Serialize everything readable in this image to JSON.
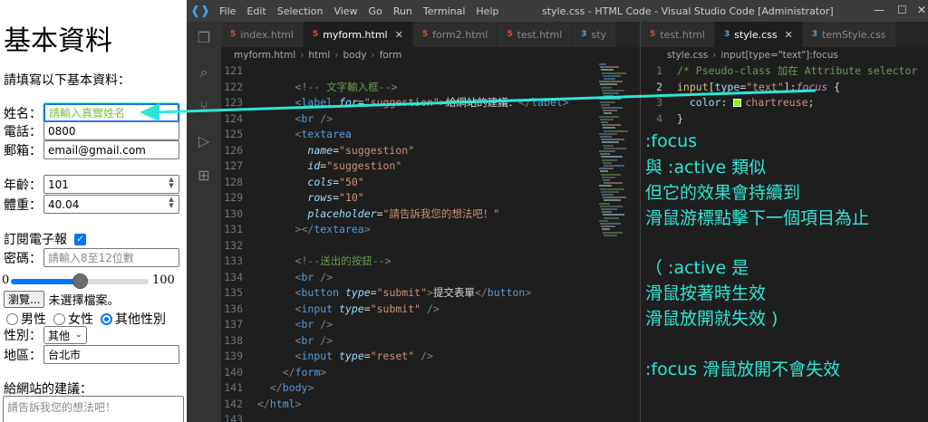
{
  "form": {
    "title": "基本資料",
    "intro": "請填寫以下基本資料：",
    "name_label": "姓名：",
    "name_placeholder": "請輸入真實姓名",
    "phone_label": "電話：",
    "phone_value": "0800",
    "email_label": "郵箱：",
    "email_value": "email@gmail.com",
    "age_label": "年齡：",
    "age_value": "101",
    "weight_label": "體重：",
    "weight_value": "40.04",
    "subscribe_label": "訂閱電子報",
    "subscribe_checked": "✓",
    "password_label": "密碼：",
    "password_placeholder": "請輸入8至12位數",
    "range_min": "0",
    "range_max": "100",
    "range_level": 0.5,
    "browse_label": "瀏覽...",
    "no_file_label": "未選擇檔案。",
    "gender_options": [
      "男性",
      "女性",
      "其他性別"
    ],
    "sex_label": "性別：",
    "sex_selected": "其他",
    "region_label": "地區：",
    "region_value": "台北市",
    "suggestion_label": "給網站的建議：",
    "suggestion_placeholder": "請告訴我您的想法吧！"
  },
  "vscode": {
    "menu": [
      "File",
      "Edit",
      "Selection",
      "View",
      "Go",
      "Run",
      "Terminal",
      "Help"
    ],
    "window_title": "style.css - HTML Code - Visual Studio Code [Administrator]",
    "left_tabs": [
      {
        "label": "index.html",
        "type": "html"
      },
      {
        "label": "myform.html",
        "type": "html"
      },
      {
        "label": "form2.html",
        "type": "html"
      },
      {
        "label": "test.html",
        "type": "html"
      },
      {
        "label": "sty",
        "type": "css"
      }
    ],
    "right_tabs": [
      {
        "label": "test.html",
        "type": "html"
      },
      {
        "label": "style.css",
        "type": "css"
      },
      {
        "label": "temStyle.css",
        "type": "css"
      }
    ],
    "left_breadcrumb": [
      "myform.html",
      "html",
      "body",
      "form"
    ],
    "right_breadcrumb": [
      "style.css",
      "input[type=\"text\"]:focus"
    ],
    "left_code": [
      {
        "n": "121",
        "segs": []
      },
      {
        "n": "122",
        "segs": [
          {
            "c": "t-c",
            "t": "      <!-- 文字輸入框-->"
          }
        ]
      },
      {
        "n": "123",
        "segs": [
          {
            "c": "t-x",
            "t": "      "
          },
          {
            "c": "t-p",
            "t": "<"
          },
          {
            "c": "t-t",
            "t": "label"
          },
          {
            "c": "t-x",
            "t": " "
          },
          {
            "c": "t-a",
            "t": "for"
          },
          {
            "c": "t-x",
            "t": "="
          },
          {
            "c": "t-s",
            "t": "\"suggestion\""
          },
          {
            "c": "t-p",
            "t": ">"
          },
          {
            "c": "t-x",
            "t": "給網站的建議："
          },
          {
            "c": "t-p",
            "t": "</"
          },
          {
            "c": "t-t",
            "t": "label"
          },
          {
            "c": "t-p",
            "t": ">"
          }
        ]
      },
      {
        "n": "124",
        "segs": [
          {
            "c": "t-x",
            "t": "      "
          },
          {
            "c": "t-p",
            "t": "<"
          },
          {
            "c": "t-t",
            "t": "br"
          },
          {
            "c": "t-x",
            "t": " "
          },
          {
            "c": "t-p",
            "t": "/>"
          }
        ]
      },
      {
        "n": "125",
        "segs": [
          {
            "c": "t-x",
            "t": "      "
          },
          {
            "c": "t-p",
            "t": "<"
          },
          {
            "c": "t-t",
            "t": "textarea"
          }
        ]
      },
      {
        "n": "126",
        "segs": [
          {
            "c": "t-x",
            "t": "        "
          },
          {
            "c": "t-a",
            "t": "name"
          },
          {
            "c": "t-x",
            "t": "="
          },
          {
            "c": "t-s",
            "t": "\"suggestion\""
          }
        ]
      },
      {
        "n": "127",
        "segs": [
          {
            "c": "t-x",
            "t": "        "
          },
          {
            "c": "t-a",
            "t": "id"
          },
          {
            "c": "t-x",
            "t": "="
          },
          {
            "c": "t-s",
            "t": "\"suggestion\""
          }
        ]
      },
      {
        "n": "128",
        "segs": [
          {
            "c": "t-x",
            "t": "        "
          },
          {
            "c": "t-a",
            "t": "cols"
          },
          {
            "c": "t-x",
            "t": "="
          },
          {
            "c": "t-s",
            "t": "\"50\""
          }
        ]
      },
      {
        "n": "129",
        "segs": [
          {
            "c": "t-x",
            "t": "        "
          },
          {
            "c": "t-a",
            "t": "rows"
          },
          {
            "c": "t-x",
            "t": "="
          },
          {
            "c": "t-s",
            "t": "\"10\""
          }
        ]
      },
      {
        "n": "130",
        "segs": [
          {
            "c": "t-x",
            "t": "        "
          },
          {
            "c": "t-a",
            "t": "placeholder"
          },
          {
            "c": "t-x",
            "t": "="
          },
          {
            "c": "t-s",
            "t": "\"請告訴我您的想法吧！\""
          }
        ]
      },
      {
        "n": "131",
        "segs": [
          {
            "c": "t-x",
            "t": "      "
          },
          {
            "c": "t-p",
            "t": "></"
          },
          {
            "c": "t-t",
            "t": "textarea"
          },
          {
            "c": "t-p",
            "t": ">"
          }
        ]
      },
      {
        "n": "132",
        "segs": []
      },
      {
        "n": "133",
        "segs": [
          {
            "c": "t-c",
            "t": "      <!--送出的按鈕-->"
          }
        ]
      },
      {
        "n": "134",
        "segs": [
          {
            "c": "t-x",
            "t": "      "
          },
          {
            "c": "t-p",
            "t": "<"
          },
          {
            "c": "t-t",
            "t": "br"
          },
          {
            "c": "t-x",
            "t": " "
          },
          {
            "c": "t-p",
            "t": "/>"
          }
        ]
      },
      {
        "n": "135",
        "segs": [
          {
            "c": "t-x",
            "t": "      "
          },
          {
            "c": "t-p",
            "t": "<"
          },
          {
            "c": "t-t",
            "t": "button"
          },
          {
            "c": "t-x",
            "t": " "
          },
          {
            "c": "t-a",
            "t": "type"
          },
          {
            "c": "t-x",
            "t": "="
          },
          {
            "c": "t-s",
            "t": "\"submit\""
          },
          {
            "c": "t-p",
            "t": ">"
          },
          {
            "c": "t-x",
            "t": "提交表單"
          },
          {
            "c": "t-p",
            "t": "</"
          },
          {
            "c": "t-t",
            "t": "button"
          },
          {
            "c": "t-p",
            "t": ">"
          }
        ]
      },
      {
        "n": "136",
        "segs": [
          {
            "c": "t-x",
            "t": "      "
          },
          {
            "c": "t-p",
            "t": "<"
          },
          {
            "c": "t-t",
            "t": "input"
          },
          {
            "c": "t-x",
            "t": " "
          },
          {
            "c": "t-a",
            "t": "type"
          },
          {
            "c": "t-x",
            "t": "="
          },
          {
            "c": "t-s",
            "t": "\"submit\""
          },
          {
            "c": "t-x",
            "t": " "
          },
          {
            "c": "t-p",
            "t": "/>"
          }
        ]
      },
      {
        "n": "137",
        "segs": [
          {
            "c": "t-x",
            "t": "      "
          },
          {
            "c": "t-p",
            "t": "<"
          },
          {
            "c": "t-t",
            "t": "br"
          },
          {
            "c": "t-x",
            "t": " "
          },
          {
            "c": "t-p",
            "t": "/>"
          }
        ]
      },
      {
        "n": "138",
        "segs": [
          {
            "c": "t-x",
            "t": "      "
          },
          {
            "c": "t-p",
            "t": "<"
          },
          {
            "c": "t-t",
            "t": "br"
          },
          {
            "c": "t-x",
            "t": " "
          },
          {
            "c": "t-p",
            "t": "/>"
          }
        ]
      },
      {
        "n": "139",
        "segs": [
          {
            "c": "t-x",
            "t": "      "
          },
          {
            "c": "t-p",
            "t": "<"
          },
          {
            "c": "t-t",
            "t": "input"
          },
          {
            "c": "t-x",
            "t": " "
          },
          {
            "c": "t-a",
            "t": "type"
          },
          {
            "c": "t-x",
            "t": "="
          },
          {
            "c": "t-s",
            "t": "\"reset\""
          },
          {
            "c": "t-x",
            "t": " "
          },
          {
            "c": "t-p",
            "t": "/>"
          }
        ]
      },
      {
        "n": "140",
        "segs": [
          {
            "c": "t-x",
            "t": "    "
          },
          {
            "c": "t-p",
            "t": "</"
          },
          {
            "c": "t-t",
            "t": "form"
          },
          {
            "c": "t-p",
            "t": ">"
          }
        ]
      },
      {
        "n": "141",
        "segs": [
          {
            "c": "t-x",
            "t": "  "
          },
          {
            "c": "t-p",
            "t": "</"
          },
          {
            "c": "t-t",
            "t": "body"
          },
          {
            "c": "t-p",
            "t": ">"
          }
        ]
      },
      {
        "n": "142",
        "segs": [
          {
            "c": "t-p",
            "t": "</"
          },
          {
            "c": "t-t",
            "t": "html"
          },
          {
            "c": "t-p",
            "t": ">"
          }
        ]
      },
      {
        "n": "143",
        "segs": []
      }
    ],
    "right_code": [
      {
        "n": "1",
        "segs": [
          {
            "c": "t-c",
            "t": "/* Pseudo-class 加在 Attribute selector"
          }
        ]
      },
      {
        "n": "2",
        "segs": [
          {
            "c": "t-sel",
            "t": "input"
          },
          {
            "c": "t-x",
            "t": "["
          },
          {
            "c": "t-prop",
            "t": "type"
          },
          {
            "c": "t-x",
            "t": "="
          },
          {
            "c": "t-s",
            "t": "\"text\""
          },
          {
            "c": "t-x",
            "t": "]:"
          },
          {
            "c": "t-kw",
            "t": "focus"
          },
          {
            "c": "t-x",
            "t": " {"
          }
        ]
      },
      {
        "n": "3",
        "segs": [
          {
            "c": "t-x",
            "t": "  "
          },
          {
            "c": "t-prop",
            "t": "color"
          },
          {
            "c": "t-x",
            "t": ": "
          },
          {
            "c": "swatch",
            "t": ""
          },
          {
            "c": "t-s",
            "t": "chartreuse"
          },
          {
            "c": "t-x",
            "t": ";"
          }
        ]
      },
      {
        "n": "4",
        "segs": [
          {
            "c": "t-x",
            "t": "}"
          }
        ]
      }
    ],
    "notes": [
      ":focus",
      "與 :active 類似",
      "但它的效果會持續到",
      "滑鼠游標點擊下一個項目為止",
      "（ :active 是",
      "滑鼠按著時生效",
      "滑鼠放開就失效 )",
      ":focus 滑鼠放開不會失效"
    ]
  },
  "colors": {
    "annotation": "#2ee6d6",
    "swatch": "#7fff00"
  }
}
